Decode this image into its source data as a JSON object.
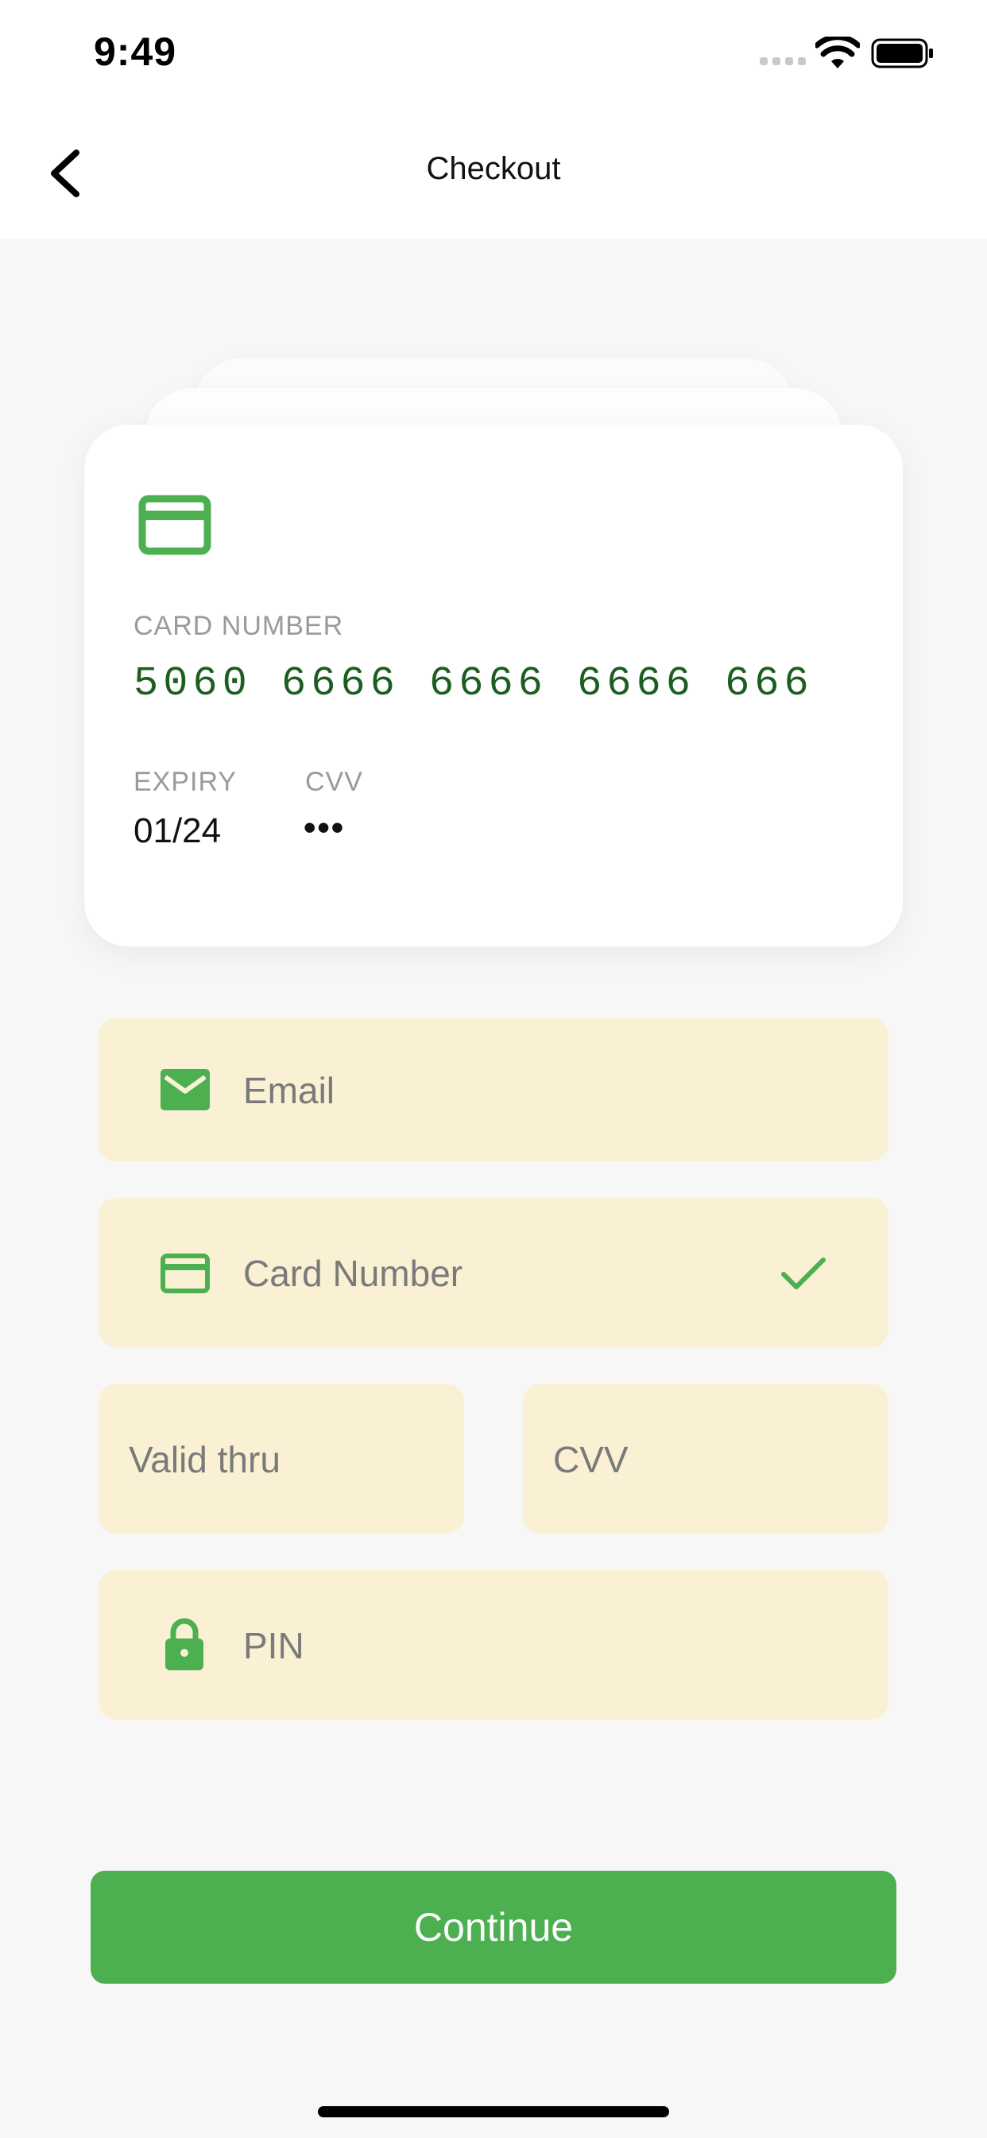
{
  "status_bar": {
    "time": "9:49"
  },
  "nav": {
    "title": "Checkout"
  },
  "card": {
    "number_label": "CARD NUMBER",
    "number": "5060 6666 6666 6666 666",
    "expiry_label": "EXPIRY",
    "expiry": "01/24",
    "cvv_label": "CVV",
    "cvv": "•••"
  },
  "form": {
    "email_placeholder": "Email",
    "card_number_placeholder": "Card Number",
    "valid_thru_placeholder": "Valid thru",
    "cvv_placeholder": "CVV",
    "pin_placeholder": "PIN"
  },
  "actions": {
    "continue_label": "Continue"
  },
  "colors": {
    "accent": "#4caf50",
    "card_number": "#1c5e21",
    "field_bg": "#faf0d3",
    "page_bg": "#f7f7f7"
  },
  "icons": {
    "back": "chevron-left-icon",
    "card": "credit-card-icon",
    "email": "mail-icon",
    "valid": "checkmark-icon",
    "pin": "lock-icon"
  }
}
